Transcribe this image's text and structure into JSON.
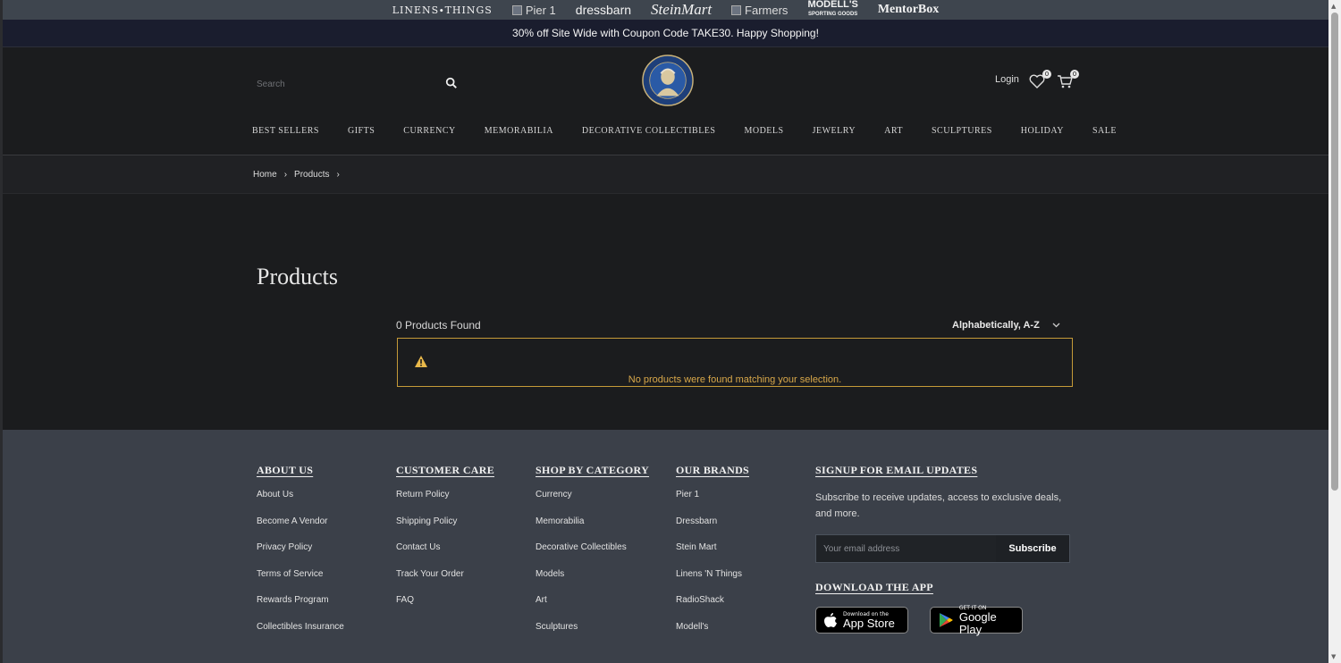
{
  "brand_bar": {
    "linens": "LINENS∙THINGS",
    "pier1": "Pier 1",
    "dressbarn": "dressbarn",
    "steinmart": "SteinMart",
    "farmers": "Farmers",
    "modells_top": "MODELL'S",
    "modells_sub": "SPORTING GOODS",
    "mentorbox": "MentorBox"
  },
  "promo": {
    "text": "30% off Site Wide with Coupon Code TAKE30. Happy Shopping!"
  },
  "header": {
    "search_placeholder": "Search",
    "logo_text": "THE FRANKLIN MINT",
    "logo_est": "EST. 1964",
    "login": "Login",
    "wishlist_count": "0",
    "cart_count": "0"
  },
  "nav": [
    "BEST SELLERS",
    "GIFTS",
    "CURRENCY",
    "MEMORABILIA",
    "DECORATIVE COLLECTIBLES",
    "MODELS",
    "JEWELRY",
    "ART",
    "SCULPTURES",
    "HOLIDAY",
    "SALE"
  ],
  "breadcrumb": {
    "home": "Home",
    "products": "Products",
    "sep": "›"
  },
  "main": {
    "title": "Products",
    "count": "0 Products Found",
    "sort": "Alphabetically, A-Z",
    "empty_message": "No products were found matching your selection."
  },
  "footer": {
    "about": {
      "title": "ABOUT US",
      "items": [
        "About Us",
        "Become A Vendor",
        "Privacy Policy",
        "Terms of Service",
        "Rewards Program",
        "Collectibles Insurance"
      ]
    },
    "care": {
      "title": "CUSTOMER CARE",
      "items": [
        "Return Policy",
        "Shipping Policy",
        "Contact Us",
        "Track Your Order",
        "FAQ"
      ]
    },
    "category": {
      "title": "SHOP BY CATEGORY",
      "items": [
        "Currency",
        "Memorabilia",
        "Decorative Collectibles",
        "Models",
        "Art",
        "Sculptures"
      ]
    },
    "brands": {
      "title": "OUR BRANDS",
      "items": [
        "Pier 1",
        "Dressbarn",
        "Stein Mart",
        "Linens 'N Things",
        "RadioShack",
        "Modell's"
      ]
    },
    "signup": {
      "title": "SIGNUP FOR EMAIL UPDATES",
      "text": "Subscribe to receive updates, access to exclusive deals, and more.",
      "placeholder": "Your email address",
      "button": "Subscribe"
    },
    "app": {
      "title": "DOWNLOAD THE APP",
      "appstore_small": "Download on the",
      "appstore_big": "App Store",
      "play_small": "GET IT ON",
      "play_big": "Google Play"
    }
  },
  "colors": {
    "accent_warning": "#c59a38",
    "footer_bg": "#3b4049",
    "page_bg": "#1b1c1e"
  }
}
